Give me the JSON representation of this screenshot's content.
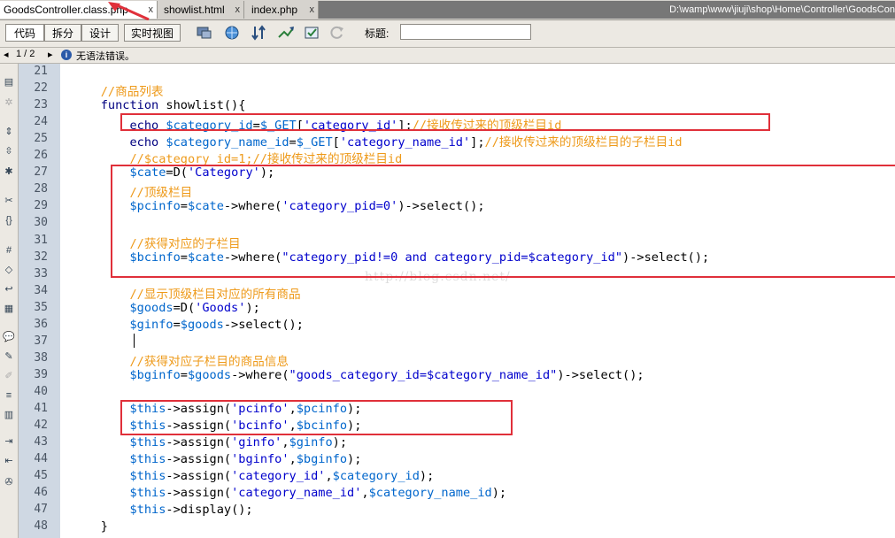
{
  "tabs": [
    {
      "label": "GoodsController.class.php",
      "active": true
    },
    {
      "label": "showlist.html",
      "active": false
    },
    {
      "label": "index.php",
      "active": false
    }
  ],
  "tab_close_glyph": "x",
  "file_path": "D:\\wamp\\www\\jiuji\\shop\\Home\\Controller\\GoodsCon",
  "toolbar": {
    "view_buttons": [
      "代码",
      "拆分",
      "设计",
      "实时视图"
    ],
    "title_label": "标题:",
    "title_value": "",
    "icons": [
      "multiscreen-icon",
      "globe-icon",
      "sort-icon",
      "debug-icon",
      "validate-icon",
      "refresh-icon"
    ]
  },
  "status": {
    "pager": "1 / 2",
    "message": "无语法错误。"
  },
  "line_numbers": [
    "21",
    "22",
    "23",
    "24",
    "25",
    "26",
    "27",
    "28",
    "29",
    "30",
    "31",
    "32",
    "33",
    "34",
    "35",
    "36",
    "37",
    "38",
    "39",
    "40",
    "41",
    "42",
    "43",
    "44",
    "45",
    "46",
    "47",
    "48"
  ],
  "code_lines": [
    [],
    [
      {
        "t": "    //商品列表",
        "c": "cm"
      }
    ],
    [
      {
        "t": "    function",
        "c": "kw"
      },
      {
        "t": " showlist(){",
        "c": "plain"
      }
    ],
    [
      {
        "t": "        echo ",
        "c": "kw"
      },
      {
        "t": "$category_id",
        "c": "var"
      },
      {
        "t": "=",
        "c": "plain"
      },
      {
        "t": "$_GET",
        "c": "var"
      },
      {
        "t": "[",
        "c": "plain"
      },
      {
        "t": "'category_id'",
        "c": "str"
      },
      {
        "t": "];",
        "c": "plain"
      },
      {
        "t": "//接收传过来的顶级栏目id",
        "c": "cm"
      }
    ],
    [
      {
        "t": "        echo ",
        "c": "kw"
      },
      {
        "t": "$category_name_id",
        "c": "var"
      },
      {
        "t": "=",
        "c": "plain"
      },
      {
        "t": "$_GET",
        "c": "var"
      },
      {
        "t": "[",
        "c": "plain"
      },
      {
        "t": "'category_name_id'",
        "c": "str"
      },
      {
        "t": "];",
        "c": "plain"
      },
      {
        "t": "//接收传过来的顶级栏目的子栏目id",
        "c": "cm"
      }
    ],
    [
      {
        "t": "        //$category_id=1;//接收传过来的顶级栏目id",
        "c": "cm"
      }
    ],
    [
      {
        "t": "        $cate",
        "c": "var"
      },
      {
        "t": "=D(",
        "c": "plain"
      },
      {
        "t": "'Category'",
        "c": "str"
      },
      {
        "t": ");",
        "c": "plain"
      }
    ],
    [
      {
        "t": "        //顶级栏目",
        "c": "cm"
      }
    ],
    [
      {
        "t": "        $pcinfo",
        "c": "var"
      },
      {
        "t": "=",
        "c": "plain"
      },
      {
        "t": "$cate",
        "c": "var"
      },
      {
        "t": "->where(",
        "c": "plain"
      },
      {
        "t": "'category_pid=0'",
        "c": "str"
      },
      {
        "t": ")->select();",
        "c": "plain"
      }
    ],
    [],
    [
      {
        "t": "        //获得对应的子栏目",
        "c": "cm"
      }
    ],
    [
      {
        "t": "        $bcinfo",
        "c": "var"
      },
      {
        "t": "=",
        "c": "plain"
      },
      {
        "t": "$cate",
        "c": "var"
      },
      {
        "t": "->where(",
        "c": "plain"
      },
      {
        "t": "\"category_pid!=0 and category_pid=$category_id\"",
        "c": "str"
      },
      {
        "t": ")->select();",
        "c": "plain"
      }
    ],
    [],
    [
      {
        "t": "        //显示顶级栏目对应的所有商品",
        "c": "cm"
      }
    ],
    [
      {
        "t": "        $goods",
        "c": "var"
      },
      {
        "t": "=D(",
        "c": "plain"
      },
      {
        "t": "'Goods'",
        "c": "str"
      },
      {
        "t": ");",
        "c": "plain"
      }
    ],
    [
      {
        "t": "        $ginfo",
        "c": "var"
      },
      {
        "t": "=",
        "c": "plain"
      },
      {
        "t": "$goods",
        "c": "var"
      },
      {
        "t": "->select();",
        "c": "plain"
      }
    ],
    [],
    [
      {
        "t": "        //获得对应子栏目的商品信息",
        "c": "cm"
      }
    ],
    [
      {
        "t": "        $bginfo",
        "c": "var"
      },
      {
        "t": "=",
        "c": "plain"
      },
      {
        "t": "$goods",
        "c": "var"
      },
      {
        "t": "->where(",
        "c": "plain"
      },
      {
        "t": "\"goods_category_id=$category_name_id\"",
        "c": "str"
      },
      {
        "t": ")->select();",
        "c": "plain"
      }
    ],
    [],
    [
      {
        "t": "        $this",
        "c": "var"
      },
      {
        "t": "->assign(",
        "c": "plain"
      },
      {
        "t": "'pcinfo'",
        "c": "str"
      },
      {
        "t": ",",
        "c": "plain"
      },
      {
        "t": "$pcinfo",
        "c": "var"
      },
      {
        "t": ");",
        "c": "plain"
      }
    ],
    [
      {
        "t": "        $this",
        "c": "var"
      },
      {
        "t": "->assign(",
        "c": "plain"
      },
      {
        "t": "'bcinfo'",
        "c": "str"
      },
      {
        "t": ",",
        "c": "plain"
      },
      {
        "t": "$bcinfo",
        "c": "var"
      },
      {
        "t": ");",
        "c": "plain"
      }
    ],
    [
      {
        "t": "        $this",
        "c": "var"
      },
      {
        "t": "->assign(",
        "c": "plain"
      },
      {
        "t": "'ginfo'",
        "c": "str"
      },
      {
        "t": ",",
        "c": "plain"
      },
      {
        "t": "$ginfo",
        "c": "var"
      },
      {
        "t": ");",
        "c": "plain"
      }
    ],
    [
      {
        "t": "        $this",
        "c": "var"
      },
      {
        "t": "->assign(",
        "c": "plain"
      },
      {
        "t": "'bginfo'",
        "c": "str"
      },
      {
        "t": ",",
        "c": "plain"
      },
      {
        "t": "$bginfo",
        "c": "var"
      },
      {
        "t": ");",
        "c": "plain"
      }
    ],
    [
      {
        "t": "        $this",
        "c": "var"
      },
      {
        "t": "->assign(",
        "c": "plain"
      },
      {
        "t": "'category_id'",
        "c": "str"
      },
      {
        "t": ",",
        "c": "plain"
      },
      {
        "t": "$category_id",
        "c": "var"
      },
      {
        "t": ");",
        "c": "plain"
      }
    ],
    [
      {
        "t": "        $this",
        "c": "var"
      },
      {
        "t": "->assign(",
        "c": "plain"
      },
      {
        "t": "'category_name_id'",
        "c": "str"
      },
      {
        "t": ",",
        "c": "plain"
      },
      {
        "t": "$category_name_id",
        "c": "var"
      },
      {
        "t": ");",
        "c": "plain"
      }
    ],
    [
      {
        "t": "        $this",
        "c": "var"
      },
      {
        "t": "->display();",
        "c": "plain"
      }
    ],
    [
      {
        "t": "    }",
        "c": "plain"
      }
    ]
  ],
  "watermark": "http://blog.csdn.net/",
  "colors": {
    "highlight_box": "#e0303a",
    "comment": "#ee9a1a",
    "variable": "#0066cc",
    "string": "#0000cc"
  }
}
